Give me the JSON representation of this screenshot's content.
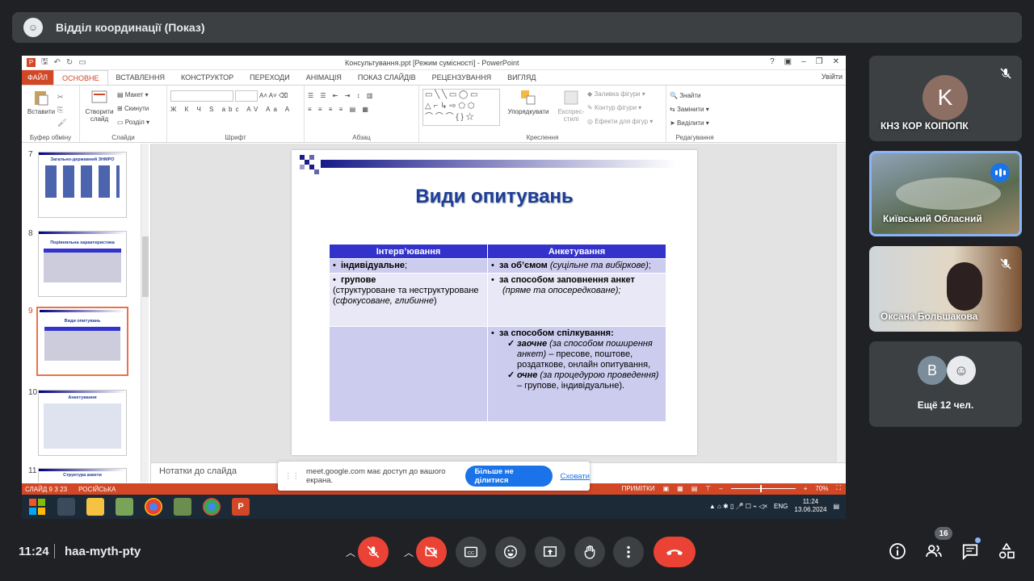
{
  "meet": {
    "title": "Відділ координації (Показ)",
    "time": "11:24",
    "meeting_code": "haa-myth-pty",
    "participants_count": "16"
  },
  "powerpoint": {
    "doc_title": "Консультування.ppt [Режим сумісності] - PowerPoint",
    "tabs": [
      "ФАЙЛ",
      "ОСНОВНЕ",
      "ВСТАВЛЕННЯ",
      "КОНСТРУКТОР",
      "ПЕРЕХОДИ",
      "АНІМАЦІЯ",
      "ПОКАЗ СЛАЙДІВ",
      "РЕЦЕНЗУВАННЯ",
      "ВИГЛЯД"
    ],
    "signin": "Увійти",
    "ribbon": {
      "paste": "Вставити",
      "clipboard": "Буфер обміну",
      "new_slide": "Створити слайд",
      "layout": "Макет",
      "reset": "Скинути",
      "section": "Розділ",
      "slides": "Слайди",
      "font": "Шрифт",
      "paragraph": "Абзац",
      "arrange": "Упорядкувати",
      "quick_styles": "Експрес-стилі",
      "fill": "Заливка фігури",
      "outline": "Контур фігури",
      "effects": "Ефекти для фігур",
      "drawing": "Креслення",
      "find": "Знайти",
      "replace": "Замінити",
      "select": "Виділити",
      "editing": "Редагування"
    },
    "thumbnails": [
      {
        "num": "7",
        "title": "Загально-державний ЗНМРО"
      },
      {
        "num": "8",
        "title": "Порівняльна характеристика"
      },
      {
        "num": "9",
        "title": "Види опитувань"
      },
      {
        "num": "10",
        "title": "Анкетування"
      },
      {
        "num": "11",
        "title": "Структура анкети"
      }
    ],
    "slide": {
      "title": "Види опитувань",
      "col1": "Інтерв’ювання",
      "col2": "Анкетування",
      "r1c1": "індивідуальне",
      "r1c1_tail": ";",
      "r1c2_bold": "за об’ємом",
      "r1c2_it": "(суцільне та вибіркове)",
      "r1c2_tail": ";",
      "r2c1_bold": "групове",
      "r2c1_a": "(структуроване та неструктуроване (",
      "r2c1_it": "сфокусоване, глибинне",
      "r2c1_b": ")",
      "r2c2_bold": "за способом заповнення анкет",
      "r2c2_it": "(пряме та опосередковане);",
      "r3c2_bold": "за способом спілкування:",
      "r3_sub1_bold": "заочне",
      "r3_sub1_it": "(за способом поширення анкет)",
      "r3_sub1_rest": " – пресове, поштове, роздаткове, онлайн опитування,",
      "r3_sub2_bold": "очне",
      "r3_sub2_it": "(за процедурою проведення)",
      "r3_sub2_rest": " – групове, індивідуальне)."
    },
    "notes": "Нотатки до слайда",
    "status": {
      "slide": "СЛАЙД 9 З 23",
      "lang": "РОСІЙСЬКА",
      "comments": "ПРИМІТКИ",
      "zoom": "70%"
    },
    "taskbar": {
      "lang": "ENG",
      "time": "11:24",
      "date": "13.06.2024"
    }
  },
  "share_notice": {
    "text": "meet.google.com має доступ до вашого екрана.",
    "stop": "Більше не ділитися",
    "hide": "Сховати"
  },
  "tiles": [
    {
      "name": "КНЗ КОР КОІПОПК",
      "initial": "K"
    },
    {
      "name": "Київський Обласний"
    },
    {
      "name": "Оксана Большакова"
    },
    {
      "name": "Ещё 12 чел.",
      "initial": "В"
    }
  ],
  "colors": {
    "pp_accent": "#d24726",
    "meet_red": "#ea4335",
    "meet_blue": "#1a73e8",
    "table_header": "#3333cc",
    "slide_title": "#1f3c99"
  }
}
